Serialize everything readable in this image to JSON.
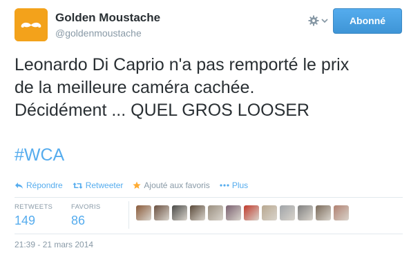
{
  "author": {
    "name": "Golden Moustache",
    "handle": "@goldenmoustache"
  },
  "follow_button": {
    "label": "Abonné"
  },
  "tweet": {
    "lines": [
      "Leonardo Di Caprio n'a pas remporté le prix",
      "de la meilleure caméra cachée.",
      "Décidément ... QUEL GROS LOOSER"
    ],
    "hashtag": "#WCA"
  },
  "actions": {
    "reply": "Répondre",
    "retweet": "Retweeter",
    "favorite": "Ajouté aux favoris",
    "more": "Plus"
  },
  "stats": {
    "retweets_label": "RETWEETS",
    "retweets_value": "149",
    "favorites_label": "FAVORIS",
    "favorites_value": "86"
  },
  "timestamp": "21:39 - 21 mars 2014",
  "icons": [
    "moustache-logo",
    "gear-icon",
    "chevron-down-icon",
    "reply-icon",
    "retweet-icon",
    "star-icon",
    "dots-icon"
  ],
  "colors": {
    "accent": "#55acee",
    "brand_orange": "#f3a21b",
    "star": "#ffac33",
    "muted": "#8899a6"
  },
  "favoriters": [
    {
      "color": "#8a5a3a"
    },
    {
      "color": "#6a5040"
    },
    {
      "color": "#4a4a48"
    },
    {
      "color": "#5a4a3a"
    },
    {
      "color": "#9a8f80"
    },
    {
      "color": "#7a6070"
    },
    {
      "color": "#c0392b"
    },
    {
      "color": "#b8a890"
    },
    {
      "color": "#a0a4a8"
    },
    {
      "color": "#808080"
    },
    {
      "color": "#7a6a5a"
    },
    {
      "color": "#b08070"
    }
  ]
}
